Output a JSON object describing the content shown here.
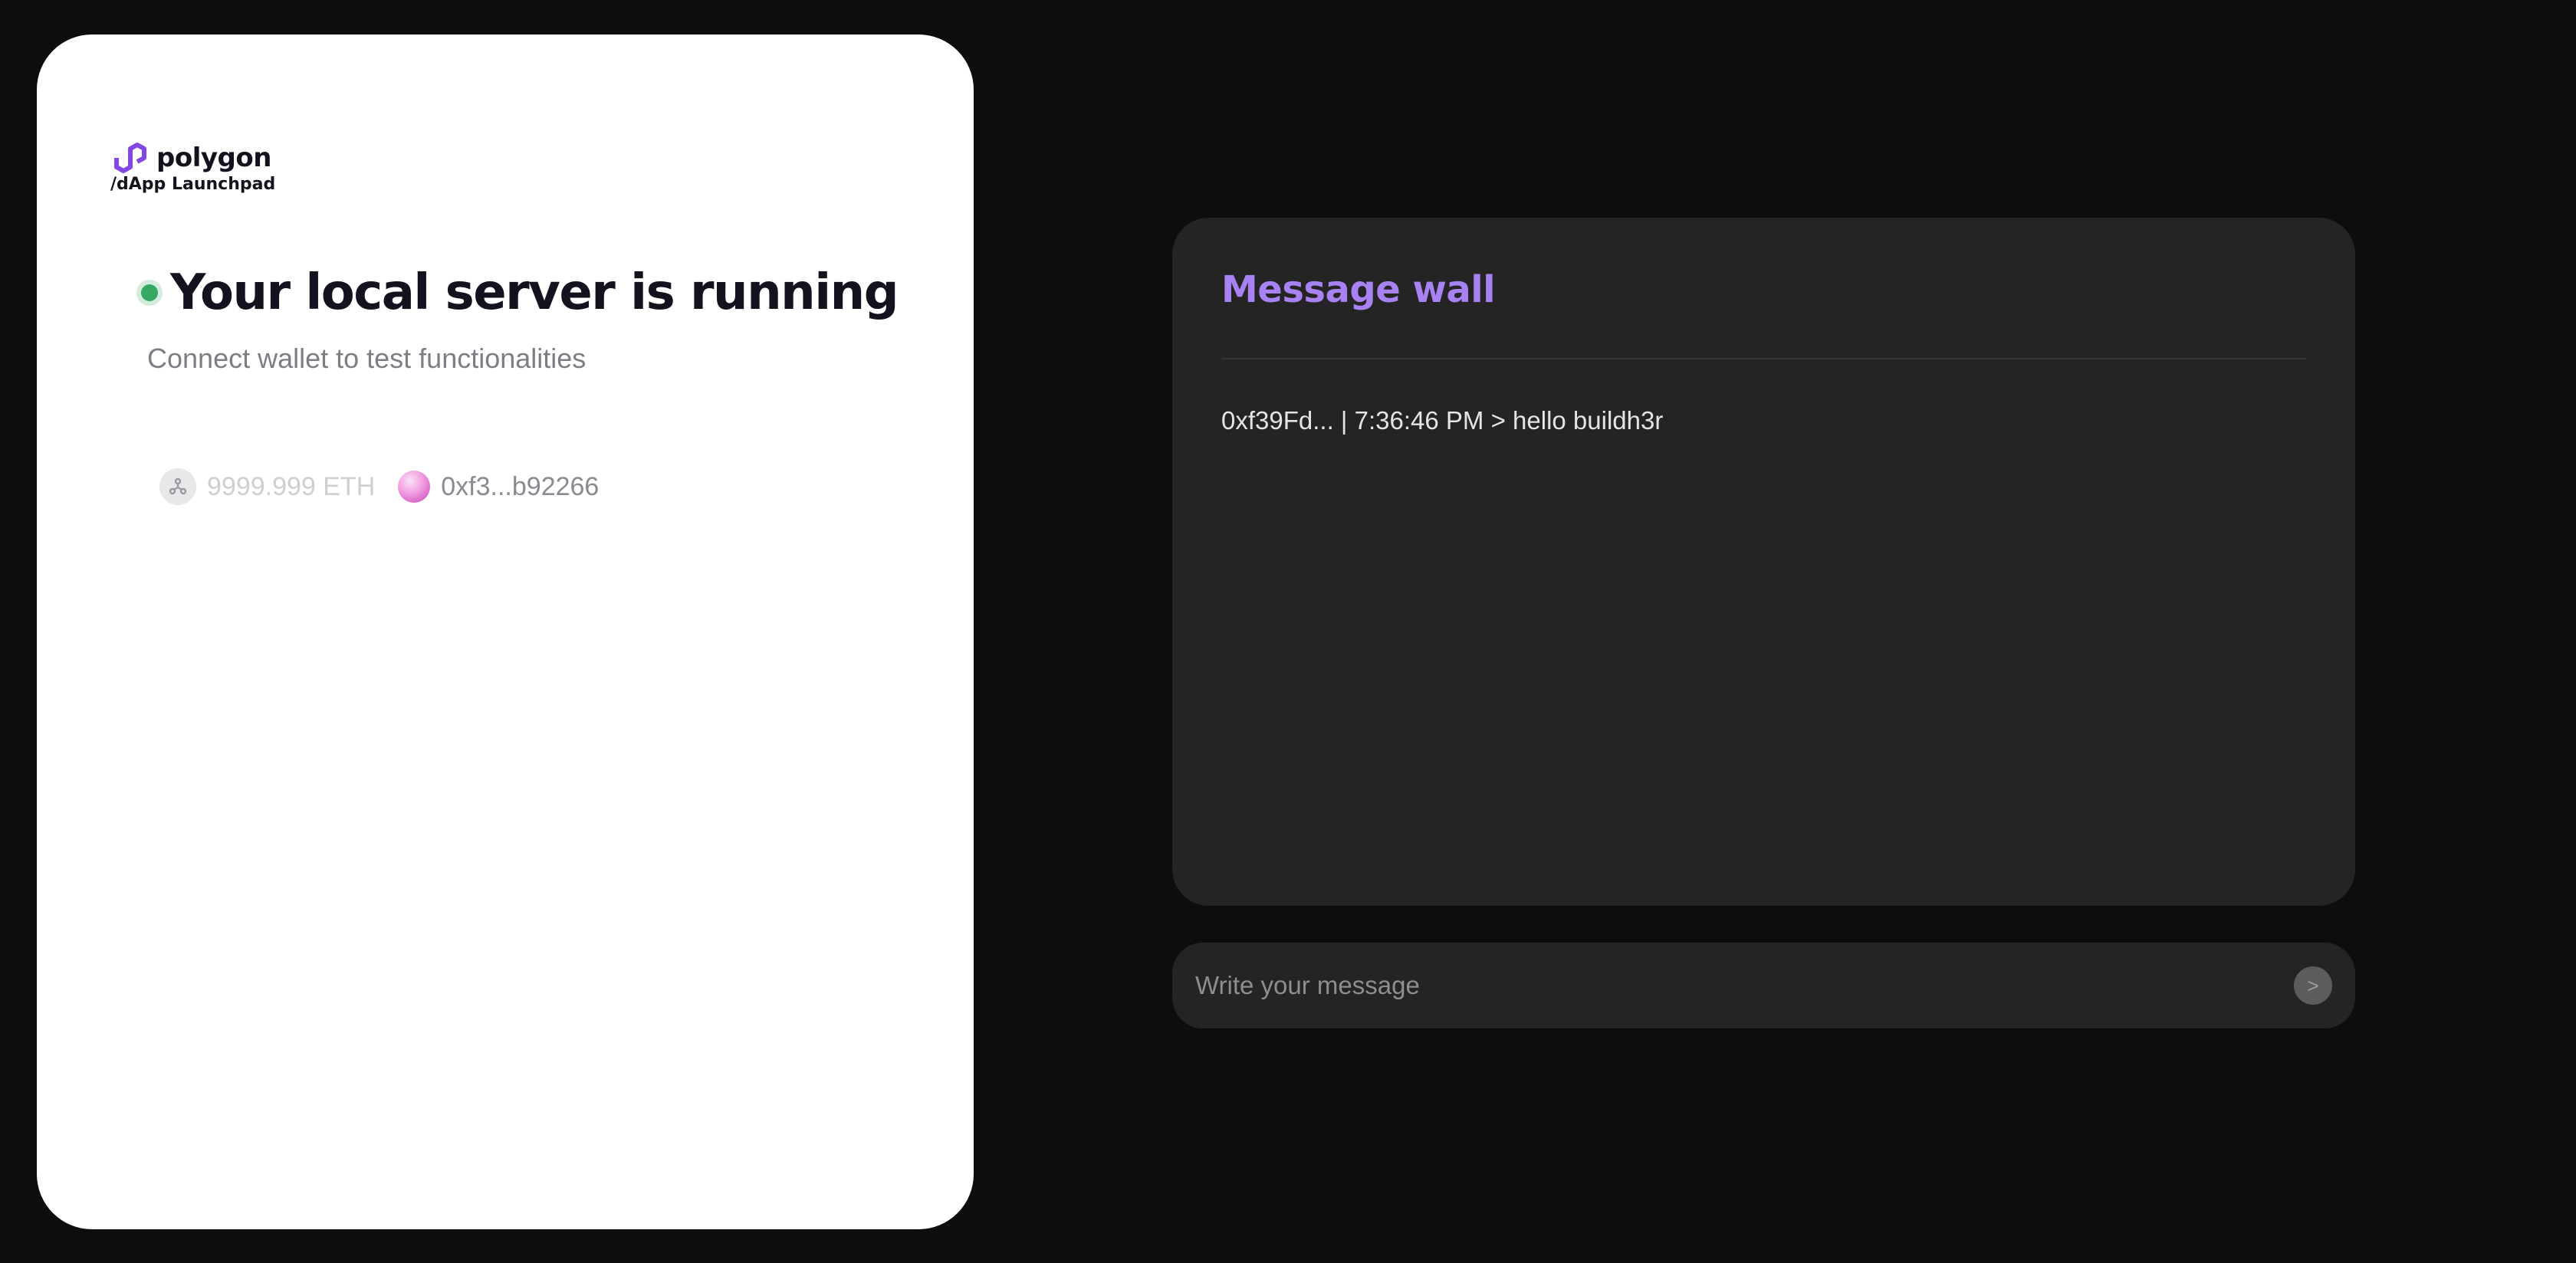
{
  "brand": {
    "name": "polygon",
    "subtitle": "/dApp Launchpad",
    "logo_icon": "polygon-logo-icon",
    "accent": "#8247e5"
  },
  "status": {
    "title": "Your local server is running",
    "subtitle": "Connect wallet to test functionalities",
    "indicator_color": "#35a862"
  },
  "wallet": {
    "network_icon": "network-icon",
    "balance": "9999.999 ETH",
    "avatar_icon": "wallet-avatar-icon",
    "address": "0xf3...b92266"
  },
  "message_wall": {
    "title": "Message wall",
    "title_color": "#a882f2",
    "messages": [
      {
        "text": "0xf39Fd... | 7:36:46 PM > hello buildh3r"
      }
    ]
  },
  "composer": {
    "placeholder": "Write your message",
    "value": "",
    "send_label": ">"
  }
}
